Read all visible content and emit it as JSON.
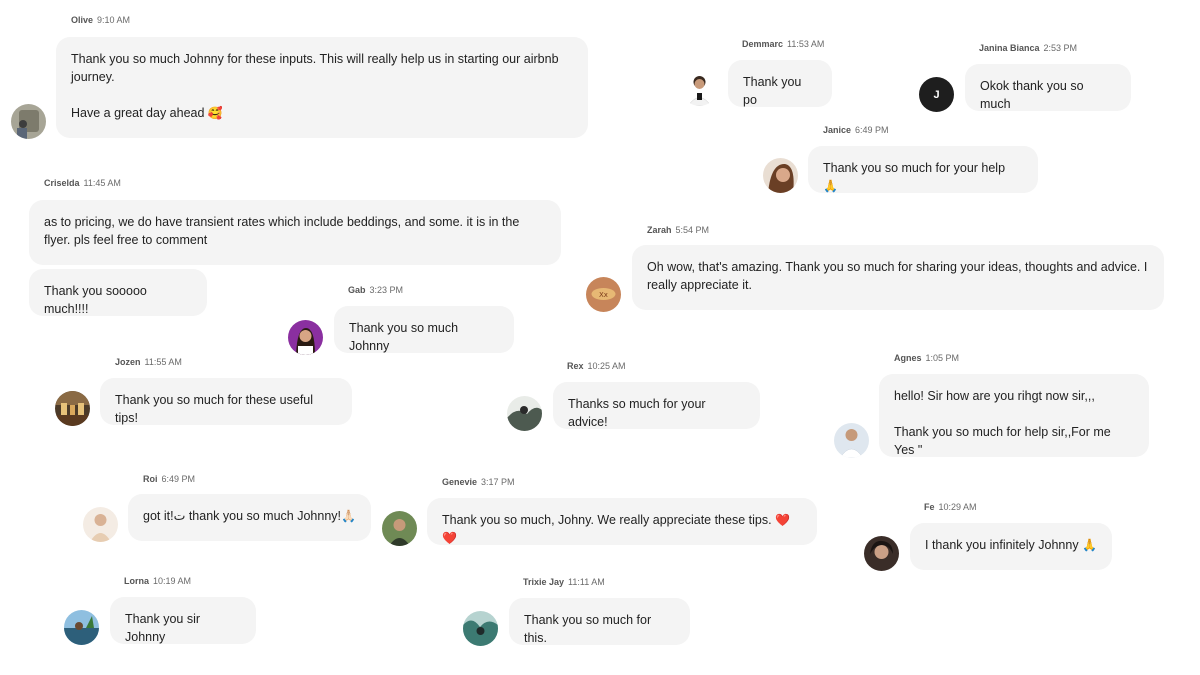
{
  "messages": [
    {
      "id": "olive",
      "name": "Olive",
      "time": "9:10 AM",
      "lines": [
        "Thank you so much Johnny for these inputs. This will really help us in starting our airbnb journey.",
        "Have a great day ahead"
      ],
      "emoji": "🥰",
      "avatar_color": "#8c8a7a"
    },
    {
      "id": "demmarc",
      "name": "Demmarc",
      "time": "11:53 AM",
      "lines": [
        "Thank you po"
      ],
      "emoji": "",
      "avatar_color": "#f5f5f5"
    },
    {
      "id": "janina",
      "name": "Janina Bianca",
      "time": "2:53 PM",
      "lines": [
        "Okok thank you so much"
      ],
      "emoji": "",
      "avatar_color": "#1e1e1e",
      "initial": "J"
    },
    {
      "id": "janice",
      "name": "Janice",
      "time": "6:49 PM",
      "lines": [
        "Thank you so much for your help"
      ],
      "emoji": "🙏",
      "avatar_color": "#b07a55"
    },
    {
      "id": "criselda",
      "name": "Criselda",
      "time": "11:45 AM",
      "lines": [
        "as to pricing, we do have transient rates which include beddings, and some. it is in the flyer. pls feel free to comment"
      ],
      "emoji": "",
      "avatar_color": ""
    },
    {
      "id": "criselda2",
      "name": "",
      "time": "",
      "lines": [
        "Thank you sooooo much!!!!"
      ],
      "emoji": "",
      "avatar_color": ""
    },
    {
      "id": "zarah",
      "name": "Zarah",
      "time": "5:54 PM",
      "lines": [
        "Oh wow, that's amazing. Thank you so much for sharing your ideas, thoughts and advice. I really appreciate it."
      ],
      "emoji": "",
      "avatar_color": "#c7855a"
    },
    {
      "id": "gab",
      "name": "Gab",
      "time": "3:23 PM",
      "lines": [
        "Thank you so much Johnny"
      ],
      "emoji": "",
      "avatar_color": "#8a2fa0"
    },
    {
      "id": "jozen",
      "name": "Jozen",
      "time": "11:55 AM",
      "lines": [
        "Thank you so much for these useful tips!"
      ],
      "emoji": "",
      "avatar_color": "#6b4f2e"
    },
    {
      "id": "rex",
      "name": "Rex",
      "time": "10:25 AM",
      "lines": [
        "Thanks so much for your advice!"
      ],
      "emoji": "",
      "avatar_color": "#4d5a50"
    },
    {
      "id": "agnes",
      "name": "Agnes",
      "time": "1:05 PM",
      "lines": [
        "hello! Sir how are you rihgt now sir,,,",
        "Thank you so much for help sir,,For me Yes \""
      ],
      "emoji": "",
      "avatar_color": "#cfd8e3"
    },
    {
      "id": "roi",
      "name": "Roi",
      "time": "6:49 PM",
      "lines": [
        "got it!ت thank you so much Johnny!"
      ],
      "emoji": "🙏🏻",
      "avatar_color": "#e8d6c4"
    },
    {
      "id": "genevie",
      "name": "Genevie",
      "time": "3:17 PM",
      "lines": [
        "Thank you so much, Johny. We really appreciate these tips."
      ],
      "emoji": "❤️ ❤️",
      "avatar_color": "#5e7a4a"
    },
    {
      "id": "fe",
      "name": "Fe",
      "time": "10:29 AM",
      "lines": [
        "I thank you infinitely Johnny"
      ],
      "emoji": "🙏",
      "avatar_color": "#4a3a33"
    },
    {
      "id": "lorna",
      "name": "Lorna",
      "time": "10:19 AM",
      "lines": [
        "Thank you sir Johnny"
      ],
      "emoji": "",
      "avatar_color": "#3f6f8f"
    },
    {
      "id": "trixie",
      "name": "Trixie Jay",
      "time": "11:11 AM",
      "lines": [
        "Thank you so much for this."
      ],
      "emoji": "",
      "avatar_color": "#3c7a72"
    }
  ]
}
